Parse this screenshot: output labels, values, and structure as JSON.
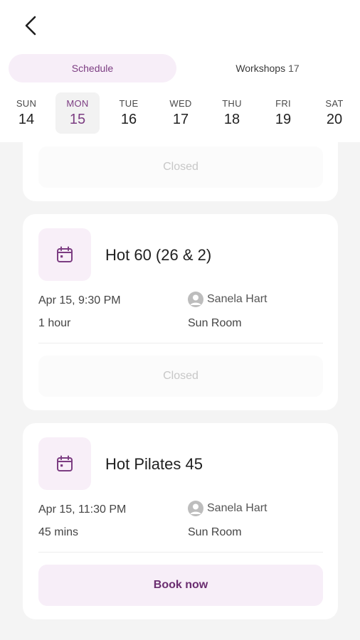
{
  "header": {
    "back_icon": "arrow-left-icon",
    "tabs": [
      {
        "label": "Schedule",
        "active": true
      },
      {
        "label": "Workshops",
        "count": "17",
        "active": false
      }
    ]
  },
  "week": [
    {
      "dow": "SUN",
      "date": "14"
    },
    {
      "dow": "MON",
      "date": "15",
      "active": true
    },
    {
      "dow": "TUE",
      "date": "16"
    },
    {
      "dow": "WED",
      "date": "17"
    },
    {
      "dow": "THU",
      "date": "18"
    },
    {
      "dow": "FRI",
      "date": "19"
    },
    {
      "dow": "SAT",
      "date": "20"
    }
  ],
  "classes": [
    {
      "action": "Closed"
    },
    {
      "title": "Hot 60 (26 & 2)",
      "datetime": "Apr 15, 9:30 PM",
      "duration": "1 hour",
      "instructor": "Sanela Hart",
      "room": "Sun Room",
      "action": "Closed",
      "icon": "calendar-icon"
    },
    {
      "title": "Hot Pilates 45",
      "datetime": "Apr 15, 11:30 PM",
      "duration": "45 mins",
      "instructor": "Sanela Hart",
      "room": "Sun Room",
      "action": "Book now",
      "icon": "calendar-icon"
    }
  ],
  "colors": {
    "accent": "#7c3d82",
    "accent_bg": "#f7eef8",
    "page_bg": "#f4f4f4"
  }
}
